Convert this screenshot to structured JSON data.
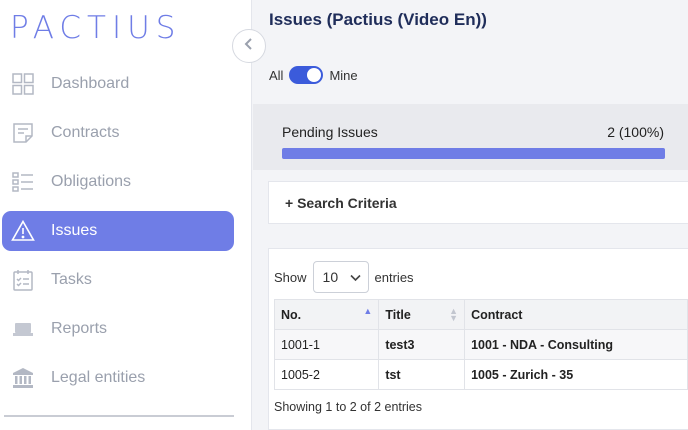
{
  "app": {
    "logo": "PACTIUS"
  },
  "sidebar": {
    "items": [
      {
        "label": "Dashboard",
        "icon": "dashboard-icon",
        "active": false
      },
      {
        "label": "Contracts",
        "icon": "contract-icon",
        "active": false
      },
      {
        "label": "Obligations",
        "icon": "obligations-icon",
        "active": false
      },
      {
        "label": "Issues",
        "icon": "warning-icon",
        "active": true
      },
      {
        "label": "Tasks",
        "icon": "tasks-icon",
        "active": false
      },
      {
        "label": "Reports",
        "icon": "reports-icon",
        "active": false
      },
      {
        "label": "Legal entities",
        "icon": "bank-icon",
        "active": false
      }
    ]
  },
  "header": {
    "title": "Issues (Pactius (Video En))"
  },
  "filter": {
    "all_label": "All",
    "mine_label": "Mine",
    "mine_selected": true
  },
  "pending": {
    "label": "Pending Issues",
    "count": "2 (100%)",
    "progress": 1.0
  },
  "search": {
    "label": "+ Search Criteria"
  },
  "table": {
    "show_label": "Show",
    "entries_label": "entries",
    "page_size": "10",
    "columns": [
      "No.",
      "Title",
      "Contract"
    ],
    "rows": [
      [
        "1001-1",
        "test3",
        "1001 - NDA - Consulting"
      ],
      [
        "1005-2",
        "tst",
        "1005 - Zurich - 35"
      ]
    ],
    "info": "Showing 1 to 2 of 2 entries"
  },
  "colors": {
    "accent": "#6f7de6",
    "toggle": "#3b5bdb",
    "title": "#1f2d5a"
  }
}
